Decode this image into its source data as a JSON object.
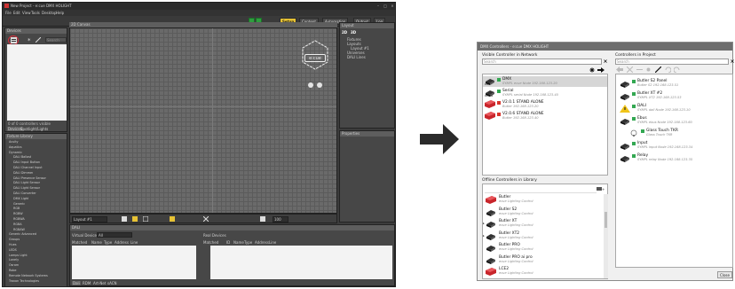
{
  "app": {
    "title": "New Project - e:cue DMX HOLIGHT",
    "menu": [
      "File",
      "Edit",
      "View",
      "Tools",
      "Desktop",
      "Help"
    ],
    "modes": [
      "Setup",
      "Content",
      "Automation",
      "Output",
      "Log"
    ],
    "active_mode": "Setup",
    "devices_panel": {
      "title": "Devices",
      "search_placeholder": "Search",
      "tabs": [
        "Devices",
        "Spotlight/Lights"
      ],
      "footer": "0 of 0 controllers visible"
    },
    "library": {
      "title": "Fixture Library",
      "items": [
        "Acuity",
        "Aquatics",
        "Dynamic",
        "DALI Ballast",
        "DALI Input Button",
        "DALI Channel Input",
        "DALI Dimmer",
        "DALI Presence Sensor",
        "DALI Light Sensor",
        "DALI Light Sensor",
        "DALI Converter",
        "DMX Light",
        "Generic",
        "RGB",
        "RGBW",
        "RGBWA",
        "RGBA",
        "RGBAW",
        "Generic Advanced",
        "Groups",
        "Hues",
        "LEDS",
        "Lamps Light",
        "Lonely",
        "Osram",
        "Robe",
        "Remote Network Systems",
        "Traxon Technologies"
      ]
    },
    "canvas": {
      "title": "2D Canvas",
      "logo": "e:cue",
      "layout_select": "Layout #1",
      "zoom": "100"
    },
    "layout_panel": {
      "title": "Layout",
      "view_2d": "2D",
      "view_3d": "3D",
      "tree": [
        "Fixtures",
        "Layouts",
        "Layout #1",
        "Universes",
        "DALI Lines"
      ]
    },
    "properties_panel": {
      "title": "Properties"
    },
    "dali": {
      "title": "DALI",
      "virtual_devices_label": "Virtual Devices",
      "virtual_devices_value": "All",
      "columns": [
        "Matched",
        "Name",
        "Type",
        "Address",
        "Line"
      ],
      "real_devices_label": "Real Devices",
      "real_columns": [
        "Matched",
        "ID",
        "Name",
        "Type",
        "Address",
        "Line"
      ],
      "tabs": [
        "Dali",
        "RDM",
        "Art-Net",
        "sACN"
      ]
    }
  },
  "dialog": {
    "title": "DMX Controllers - e:cue DMX HOLIGHT",
    "visible_section": "Visible Controller in Network",
    "search_placeholder": "Search",
    "network_controllers": [
      {
        "name": "DMX",
        "sub": "SYMPL ecue Node 192.168.123.20",
        "icon_label": "DMX",
        "status": "green"
      },
      {
        "name": "Serial",
        "sub": "SYMPL serial Node 192.168.123.40",
        "icon_label": "RS-232",
        "status": "green"
      },
      {
        "name": "V2.0.1 STAND ALONE",
        "sub": "Butler 192.168.123.20",
        "icon_label": "",
        "status": "red"
      },
      {
        "name": "V2.0.6 STAND ALONE",
        "sub": "Butler 192.168.123.40",
        "icon_label": "",
        "status": "red"
      }
    ],
    "offline_section": "Offline Controllers in Library",
    "offline_controllers": [
      {
        "name": "Butler",
        "sub": "ecue Lighting Control"
      },
      {
        "name": "Butler S2",
        "sub": "ecue Lighting Control"
      },
      {
        "name": "Butler XT",
        "sub": "ecue Lighting Control"
      },
      {
        "name": "Butler XT2",
        "sub": "ecue Lighting Control"
      },
      {
        "name": "Butler PRO",
        "sub": "ecue Lighting Control"
      },
      {
        "name": "Butler PRO ai pro",
        "sub": "ecue Lighting Control"
      },
      {
        "name": "LCE2",
        "sub": "ecue Lighting Control"
      }
    ],
    "project_section": "Controllers in Project",
    "project_controllers": [
      {
        "name": "Butler S2 Panel",
        "sub": "Butler S2 192.168.123.51",
        "indent": 0,
        "status": "green"
      },
      {
        "name": "Butler XT #2",
        "sub": "SYMPL XT2 192.168.123.53",
        "indent": 0,
        "status": "green"
      },
      {
        "name": "DALI",
        "sub": "SYMPL dali Node 192.168.123.10",
        "indent": 0,
        "status": "green"
      },
      {
        "name": "Ebus",
        "sub": "SYMPL ebus Node 192.168.123.60",
        "indent": 0,
        "status": "green"
      },
      {
        "name": "Glass Touch TKR",
        "sub": "Glass Touch TKR",
        "indent": 1,
        "status": "green"
      },
      {
        "name": "Input",
        "sub": "SYMPL input Node 192.168.123.34",
        "indent": 0,
        "status": "green"
      },
      {
        "name": "Relay",
        "sub": "SYMPL relay Node 192.168.123.35",
        "indent": 0,
        "status": "green"
      }
    ],
    "close_label": "Close"
  }
}
